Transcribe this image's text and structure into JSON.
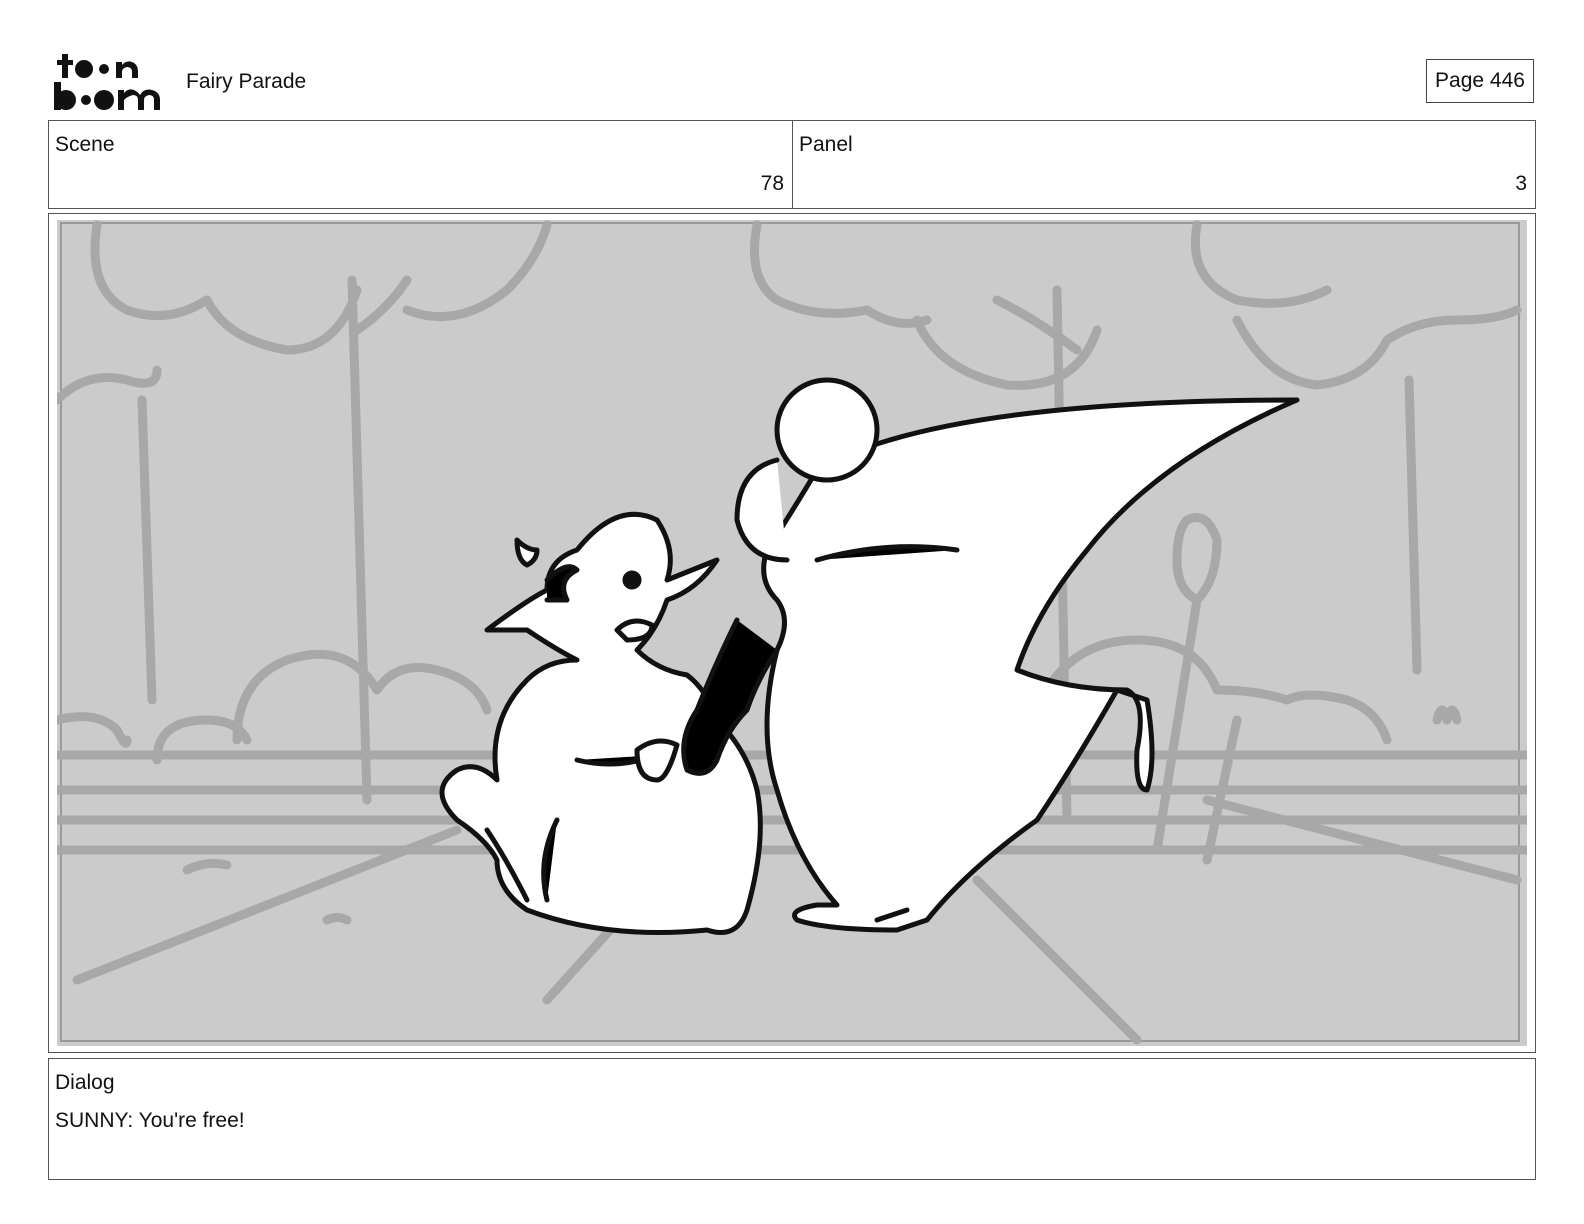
{
  "brand": {
    "logo_text": "toon boom",
    "logo_icon": "toon-boom-logo"
  },
  "project": {
    "title": "Fairy Parade"
  },
  "page": {
    "label": "Page 446"
  },
  "scene": {
    "label": "Scene",
    "value": "78"
  },
  "panel": {
    "label": "Panel",
    "value": "3"
  },
  "dialog": {
    "label": "Dialog",
    "text": "SUNNY: You're free!"
  },
  "colors": {
    "frame_bg": "#cbcbcb",
    "sketch_bg_lines": "#a8a8a8",
    "ink": "#111111",
    "border": "#555555"
  }
}
